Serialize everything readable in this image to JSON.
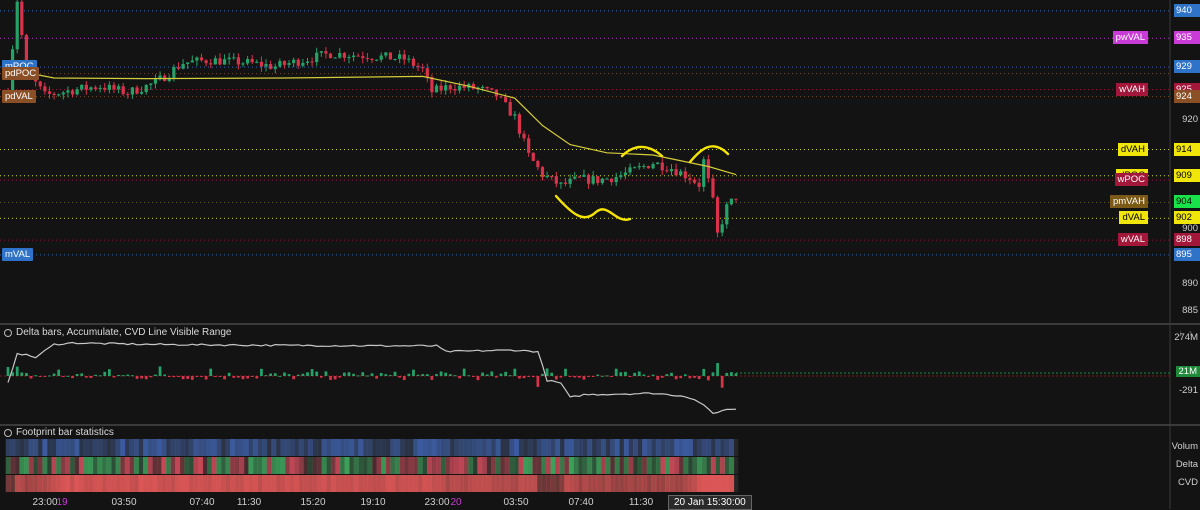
{
  "colors": {
    "background": "#131313",
    "candle_up": "#26a269",
    "candle_down": "#d8334a",
    "vwap": "#d4cc3a",
    "annotation": "#f5e400",
    "cvd_line": "#c8c8c8",
    "volume_strip": "#2c4f9a",
    "delta_strip_pos": "#2e9a4e",
    "delta_strip_neg": "#c23a4a",
    "cvd_strip": "#d84848"
  },
  "panels": {
    "delta_title": "Delta bars, Accumulate, CVD Line Visible Range",
    "footprint_title": "Footprint bar statistics",
    "stat_rows": [
      "Volum",
      "Delta",
      "CVD"
    ]
  },
  "left_labels": [
    {
      "text": "mPOC",
      "bg": "#2f73c8",
      "fg": "#ffffff",
      "price": 9297
    },
    {
      "text": "pdPOC",
      "bg": "#8a4f24",
      "fg": "#ffffff",
      "price": 9285
    },
    {
      "text": "pdVAL",
      "bg": "#8a4f24",
      "fg": "#ffffff",
      "price": 9243
    },
    {
      "text": "mVAL",
      "bg": "#2f73c8",
      "fg": "#ffffff",
      "price": 8953
    }
  ],
  "right_labels": [
    {
      "text": "pwVAL",
      "bg": "#c93bd6",
      "fg": "#ffffff",
      "price": 9350
    },
    {
      "text": "wVAH",
      "bg": "#a3173a",
      "fg": "#ffffff",
      "price": 9256
    },
    {
      "text": "dVAH",
      "bg": "#f0e60a",
      "fg": "#000000",
      "price": 9146
    },
    {
      "text": "dPOC",
      "bg": "#f0e60a",
      "fg": "#000000",
      "price": 9098
    },
    {
      "text": "wPOC",
      "bg": "#a3173a",
      "fg": "#ffffff",
      "price": 9090
    },
    {
      "text": "pmVAH",
      "bg": "#7a5a16",
      "fg": "#ffffff",
      "price": 9049
    },
    {
      "text": "dVAL",
      "bg": "#f0e60a",
      "fg": "#000000",
      "price": 9020
    },
    {
      "text": "wVAL",
      "bg": "#a3173a",
      "fg": "#ffffff",
      "price": 8980
    }
  ],
  "price_tags": [
    {
      "text": "940",
      "bg": "#2f73c8",
      "fg": "#ffffff",
      "price": 9400
    },
    {
      "text": "935",
      "bg": "#c93bd6",
      "fg": "#ffffff",
      "price": 9350
    },
    {
      "text": "929",
      "bg": "#2f73c8",
      "fg": "#ffffff",
      "price": 9297
    },
    {
      "text": "925",
      "bg": "#a3173a",
      "fg": "#ffffff",
      "price": 9256
    },
    {
      "text": "924",
      "bg": "#8a4f24",
      "fg": "#ffffff",
      "price": 9243
    },
    {
      "text": "914",
      "bg": "#f0e60a",
      "fg": "#000000",
      "price": 9146
    },
    {
      "text": "909",
      "bg": "#f0e60a",
      "fg": "#000000",
      "price": 9098
    },
    {
      "text": "904",
      "bg": "#19e34a",
      "fg": "#000000",
      "price": 9049
    },
    {
      "text": "902",
      "bg": "#f0e60a",
      "fg": "#000000",
      "price": 9020
    },
    {
      "text": "898",
      "bg": "#a3173a",
      "fg": "#ffffff",
      "price": 8980
    },
    {
      "text": "895",
      "bg": "#2f73c8",
      "fg": "#ffffff",
      "price": 8953
    }
  ],
  "axis_ticks": [
    {
      "text": "920",
      "price": 9200
    },
    {
      "text": "900",
      "price": 9000
    },
    {
      "text": "890",
      "price": 8900
    },
    {
      "text": "885",
      "price": 8850
    }
  ],
  "cvd_axis": [
    {
      "text": "274M",
      "value": 274
    },
    {
      "text": "21M",
      "value": 21,
      "bg": "#1f8a3a"
    },
    {
      "text": "-291",
      "value": -291
    }
  ],
  "time_ticks": [
    "23:00",
    "03:50",
    "07:40",
    "11:30",
    "15:20",
    "19:10",
    "23:00",
    "03:50",
    "07:40",
    "11:30"
  ],
  "day_marks": [
    "19",
    "20"
  ],
  "cursor_date": "20 Jan 15:30:00",
  "chart_data": {
    "type": "candlestick",
    "price_range": [
      8830,
      9420
    ],
    "levels": [
      {
        "name": "mPOC",
        "price": 9297
      },
      {
        "name": "pdPOC",
        "price": 9285
      },
      {
        "name": "pdVAL",
        "price": 9243
      },
      {
        "name": "pwVAL",
        "price": 9350
      },
      {
        "name": "wVAH",
        "price": 9256
      },
      {
        "name": "dVAH",
        "price": 9146
      },
      {
        "name": "dPOC",
        "price": 9098
      },
      {
        "name": "wPOC",
        "price": 9090
      },
      {
        "name": "pmVAH",
        "price": 9049
      },
      {
        "name": "dVAL",
        "price": 9020
      },
      {
        "name": "wVAL",
        "price": 8980
      },
      {
        "name": "mVAL",
        "price": 8953
      }
    ],
    "price_path": [
      [
        0,
        9250
      ],
      [
        2,
        9420
      ],
      [
        4,
        9290
      ],
      [
        8,
        9245
      ],
      [
        14,
        9255
      ],
      [
        20,
        9262
      ],
      [
        26,
        9250
      ],
      [
        32,
        9268
      ],
      [
        38,
        9305
      ],
      [
        44,
        9310
      ],
      [
        52,
        9305
      ],
      [
        58,
        9298
      ],
      [
        64,
        9310
      ],
      [
        70,
        9322
      ],
      [
        78,
        9318
      ],
      [
        86,
        9312
      ],
      [
        90,
        9292
      ],
      [
        92,
        9252
      ],
      [
        96,
        9262
      ],
      [
        102,
        9258
      ],
      [
        106,
        9245
      ],
      [
        110,
        9205
      ],
      [
        113,
        9135
      ],
      [
        116,
        9100
      ],
      [
        120,
        9080
      ],
      [
        124,
        9092
      ],
      [
        128,
        9090
      ],
      [
        132,
        9096
      ],
      [
        136,
        9108
      ],
      [
        140,
        9122
      ],
      [
        144,
        9112
      ],
      [
        148,
        9095
      ],
      [
        150,
        9082
      ],
      [
        151,
        9125
      ],
      [
        153,
        9050
      ],
      [
        154,
        8990
      ],
      [
        156,
        9040
      ],
      [
        158,
        9060
      ]
    ],
    "vwap_path": [
      [
        2,
        9290
      ],
      [
        10,
        9277
      ],
      [
        30,
        9276
      ],
      [
        60,
        9277
      ],
      [
        90,
        9280
      ],
      [
        100,
        9262
      ],
      [
        110,
        9240
      ],
      [
        116,
        9190
      ],
      [
        122,
        9155
      ],
      [
        130,
        9140
      ],
      [
        140,
        9136
      ],
      [
        152,
        9115
      ],
      [
        158,
        9100
      ]
    ],
    "cvd_path": [
      [
        0,
        -60
      ],
      [
        2,
        150
      ],
      [
        6,
        120
      ],
      [
        10,
        210
      ],
      [
        14,
        220
      ],
      [
        30,
        210
      ],
      [
        50,
        205
      ],
      [
        80,
        200
      ],
      [
        93,
        200
      ],
      [
        95,
        160
      ],
      [
        110,
        170
      ],
      [
        115,
        160
      ],
      [
        117,
        -40
      ],
      [
        120,
        -60
      ],
      [
        122,
        -160
      ],
      [
        125,
        -140
      ],
      [
        140,
        -130
      ],
      [
        147,
        -150
      ],
      [
        150,
        -190
      ],
      [
        153,
        -270
      ],
      [
        155,
        -250
      ],
      [
        157,
        -240
      ]
    ],
    "cvd_range": [
      -330,
      310
    ]
  }
}
